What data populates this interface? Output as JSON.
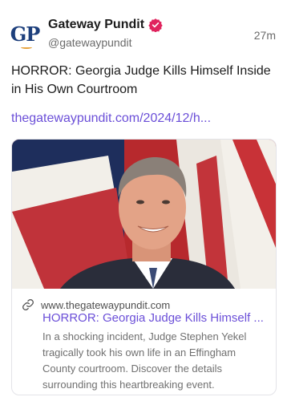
{
  "post": {
    "author_name": "Gateway Pundit",
    "author_handle": "@gatewaypundit",
    "avatar_text": "GP",
    "timestamp": "27m",
    "text": "HORROR: Georgia Judge Kills Himself Inside in His Own Courtroom",
    "link_text": "thegatewaypundit.com/2024/12/h...",
    "verified_icon": "verified-badge-icon",
    "accent_color": "#6b4fd8",
    "badge_color": "#e0245e"
  },
  "card": {
    "domain": "www.thegatewaypundit.com",
    "title": "HORROR: Georgia Judge Kills Himself ...",
    "description": "In a shocking incident, Judge Stephen Yekel tragically took his own life in an Effingham County courtroom. Discover the details surrounding this heartbreaking event.",
    "link_icon": "link-icon"
  }
}
